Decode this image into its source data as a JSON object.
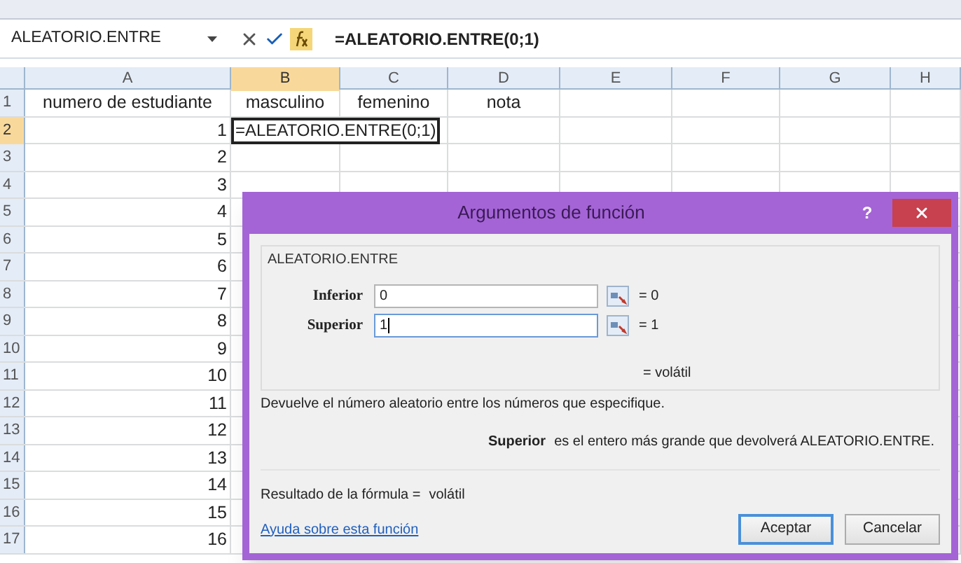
{
  "name_box": {
    "value": "ALEATORIO.ENTRE"
  },
  "formula_bar": {
    "value": "=ALEATORIO.ENTRE(0;1)"
  },
  "columns": [
    {
      "label": "A",
      "selected": false
    },
    {
      "label": "B",
      "selected": true
    },
    {
      "label": "C",
      "selected": false
    },
    {
      "label": "D",
      "selected": false
    },
    {
      "label": "E",
      "selected": false
    },
    {
      "label": "F",
      "selected": false
    },
    {
      "label": "G",
      "selected": false
    },
    {
      "label": "H",
      "selected": false
    }
  ],
  "rows": [
    {
      "label": "1",
      "selected": false,
      "cells": [
        {
          "text": "numero de estudiante",
          "editing": false
        },
        {
          "text": "masculino",
          "editing": false
        },
        {
          "text": "femenino",
          "editing": false
        },
        {
          "text": "nota",
          "editing": false
        }
      ]
    },
    {
      "label": "2",
      "selected": true,
      "cells": [
        {
          "text": "1",
          "editing": false
        },
        {
          "text": "=ALEATORIO.ENTRE(0;1)",
          "editing": true
        }
      ]
    },
    {
      "label": "3",
      "selected": false,
      "cells": [
        {
          "text": "2",
          "editing": false
        }
      ]
    },
    {
      "label": "4",
      "selected": false,
      "cells": [
        {
          "text": "3",
          "editing": false
        }
      ]
    },
    {
      "label": "5",
      "selected": false,
      "cells": [
        {
          "text": "4",
          "editing": false
        }
      ]
    },
    {
      "label": "6",
      "selected": false,
      "cells": [
        {
          "text": "5",
          "editing": false
        }
      ]
    },
    {
      "label": "7",
      "selected": false,
      "cells": [
        {
          "text": "6",
          "editing": false
        }
      ]
    },
    {
      "label": "8",
      "selected": false,
      "cells": [
        {
          "text": "7",
          "editing": false
        }
      ]
    },
    {
      "label": "9",
      "selected": false,
      "cells": [
        {
          "text": "8",
          "editing": false
        }
      ]
    },
    {
      "label": "10",
      "selected": false,
      "cells": [
        {
          "text": "9",
          "editing": false
        }
      ]
    },
    {
      "label": "11",
      "selected": false,
      "cells": [
        {
          "text": "10",
          "editing": false
        }
      ]
    },
    {
      "label": "12",
      "selected": false,
      "cells": [
        {
          "text": "11",
          "editing": false
        }
      ]
    },
    {
      "label": "13",
      "selected": false,
      "cells": [
        {
          "text": "12",
          "editing": false
        }
      ]
    },
    {
      "label": "14",
      "selected": false,
      "cells": [
        {
          "text": "13",
          "editing": false
        }
      ]
    },
    {
      "label": "15",
      "selected": false,
      "cells": [
        {
          "text": "14",
          "editing": false
        }
      ]
    },
    {
      "label": "16",
      "selected": false,
      "cells": [
        {
          "text": "15",
          "editing": false
        }
      ]
    },
    {
      "label": "17",
      "selected": false,
      "cells": [
        {
          "text": "16",
          "editing": false
        }
      ]
    }
  ],
  "dialog": {
    "title": "Argumentos de función",
    "help": "?",
    "function_name": "ALEATORIO.ENTRE",
    "arguments": [
      {
        "label": "Inferior",
        "value": "0",
        "result": "= 0",
        "focused": false
      },
      {
        "label": "Superior",
        "value": "1",
        "result": "= 1",
        "focused": true
      }
    ],
    "result": "= volátil",
    "description": "Devuelve el número aleatorio entre los números que especifique.",
    "argument_help": {
      "name": "Superior",
      "text": "es el entero más grande que devolverá ALEATORIO.ENTRE."
    },
    "formula_result": {
      "label": "Resultado de la fórmula =",
      "value": "volátil"
    },
    "help_link": "Ayuda sobre esta función",
    "buttons": [
      {
        "label": "Aceptar",
        "default": true
      },
      {
        "label": "Cancelar",
        "default": false
      }
    ]
  }
}
